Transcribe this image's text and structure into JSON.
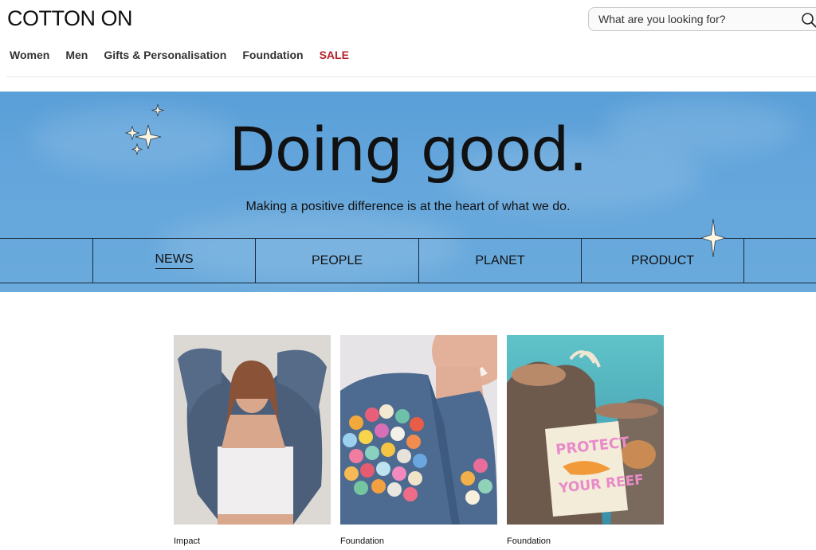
{
  "brand": {
    "logo_text": "COTTON ON"
  },
  "search": {
    "placeholder": "What are you looking for?",
    "value": ""
  },
  "nav": {
    "items": [
      {
        "label": "Women"
      },
      {
        "label": "Men"
      },
      {
        "label": "Gifts & Personalisation"
      },
      {
        "label": "Foundation"
      },
      {
        "label": "SALE"
      }
    ]
  },
  "hero": {
    "title": "Doing good.",
    "subtitle": "Making a positive difference is at the heart of what we do.",
    "tabs": [
      {
        "label": "NEWS",
        "active": true
      },
      {
        "label": "PEOPLE",
        "active": false
      },
      {
        "label": "PLANET",
        "active": false
      },
      {
        "label": "PRODUCT",
        "active": false
      }
    ]
  },
  "cards": [
    {
      "label": "Impact"
    },
    {
      "label": "Foundation"
    },
    {
      "label": "Foundation"
    }
  ],
  "colors": {
    "sale": "#b5232a",
    "hero_bg": "#64a6dc",
    "text": "#111111"
  }
}
